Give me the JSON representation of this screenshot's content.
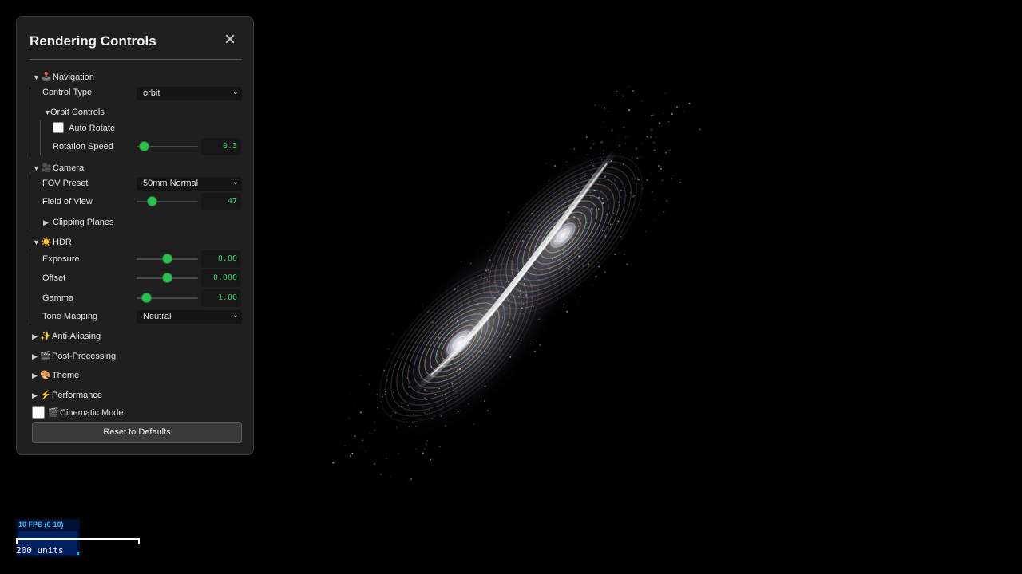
{
  "panel": {
    "title": "Rendering Controls",
    "close_icon": "close-icon",
    "reset_label": "Reset to Defaults"
  },
  "navigation": {
    "label": "Navigation",
    "icon": "joystick-icon",
    "expanded": true,
    "control_type": {
      "label": "Control Type",
      "value": "orbit"
    },
    "orbit_controls": {
      "label": "Orbit Controls",
      "expanded": true,
      "auto_rotate": {
        "label": "Auto Rotate",
        "checked": false
      },
      "rotation_speed": {
        "label": "Rotation Speed",
        "value": "0.3",
        "fraction": 0.05
      }
    }
  },
  "camera": {
    "label": "Camera",
    "icon": "video-camera-icon",
    "expanded": true,
    "fov_preset": {
      "label": "FOV Preset",
      "value": "50mm Normal"
    },
    "field_of_view": {
      "label": "Field of View",
      "value": "47",
      "fraction": 0.2
    },
    "clipping_planes": {
      "label": "Clipping Planes",
      "expanded": false
    }
  },
  "hdr": {
    "label": "HDR",
    "icon": "sun-icon",
    "expanded": true,
    "exposure": {
      "label": "Exposure",
      "value": "0.00",
      "fraction": 0.5
    },
    "offset": {
      "label": "Offset",
      "value": "0.000",
      "fraction": 0.5
    },
    "gamma": {
      "label": "Gamma",
      "value": "1.00",
      "fraction": 0.1
    },
    "tone_mapping": {
      "label": "Tone Mapping",
      "value": "Neutral"
    }
  },
  "sections": {
    "anti_aliasing": {
      "label": "Anti-Aliasing",
      "icon": "sparkles-icon"
    },
    "post_processing": {
      "label": "Post-Processing",
      "icon": "clapperboard-icon"
    },
    "theme": {
      "label": "Theme",
      "icon": "palette-icon"
    },
    "performance": {
      "label": "Performance",
      "icon": "lightning-icon"
    }
  },
  "cinematic_mode": {
    "label": "Cinematic Mode",
    "icon": "clapperboard-icon",
    "checked": false
  },
  "overlay": {
    "fps_label": "10 FPS (0-10)",
    "scale_label": "200 units"
  },
  "colors": {
    "accent": "#2fbf50",
    "value_text": "#39d164",
    "panel_bg": "#1f1f1f",
    "fps_text": "#2ec0ff"
  }
}
